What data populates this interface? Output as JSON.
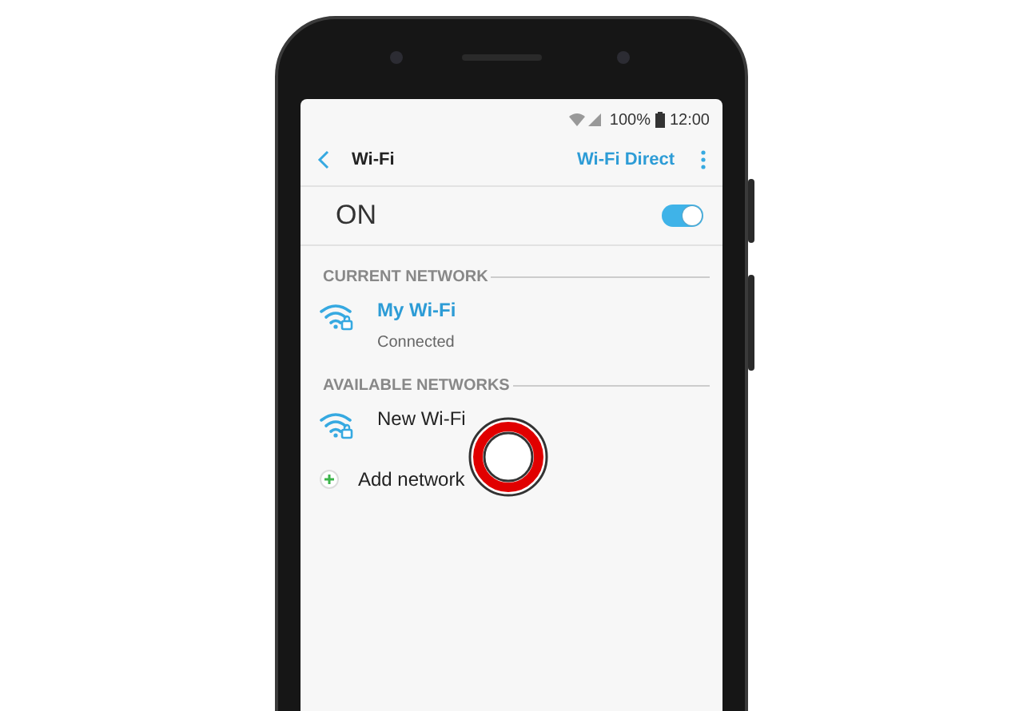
{
  "status_bar": {
    "battery": "100%",
    "time": "12:00"
  },
  "header": {
    "title": "Wi-Fi",
    "action": "Wi-Fi Direct"
  },
  "master_switch": {
    "label": "ON",
    "on": true
  },
  "sections": [
    {
      "heading": "CURRENT NETWORK",
      "networks": [
        {
          "name": "My Wi-Fi",
          "status": "Connected",
          "connected": true
        }
      ]
    },
    {
      "heading": "AVAILABLE NETWORKS",
      "networks": [
        {
          "name": "New Wi-Fi",
          "connected": false
        }
      ]
    }
  ],
  "add_network": "Add network"
}
